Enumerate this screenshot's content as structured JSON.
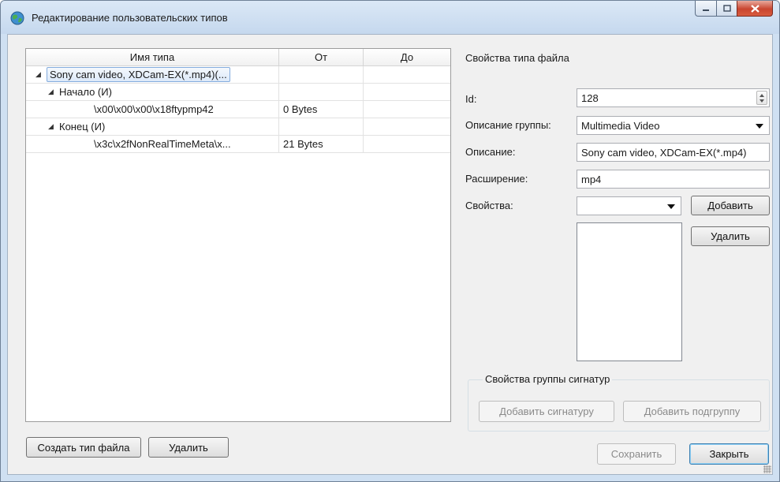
{
  "window": {
    "title": "Редактирование пользовательских типов"
  },
  "tree": {
    "columns": [
      "Имя типа",
      "От",
      "До"
    ],
    "rows": [
      {
        "name": "Sony cam video, XDCam-EX(*.mp4)(...",
        "from": "",
        "to": "",
        "expanded": true,
        "selected": true
      },
      {
        "name": "Начало (И)",
        "from": "",
        "to": "",
        "expanded": true
      },
      {
        "name": "\\x00\\x00\\x00\\x18ftypmp42",
        "from": "0 Bytes",
        "to": ""
      },
      {
        "name": "Конец (И)",
        "from": "",
        "to": "",
        "expanded": true
      },
      {
        "name": "\\x3c\\x2fNonRealTimeMeta\\x...",
        "from": "21 Bytes",
        "to": ""
      }
    ]
  },
  "left_buttons": {
    "create": "Создать тип файла",
    "delete": "Удалить"
  },
  "properties": {
    "heading": "Свойства типа файла",
    "id_label": "Id:",
    "id_value": "128",
    "group_label": "Описание группы:",
    "group_value": "Multimedia Video",
    "desc_label": "Описание:",
    "desc_value": "Sony cam video, XDCam-EX(*.mp4)",
    "ext_label": "Расширение:",
    "ext_value": "mp4",
    "props_label": "Свойства:",
    "props_value": "",
    "add_button": "Добавить",
    "remove_button": "Удалить"
  },
  "signature_group": {
    "title": "Свойства группы сигнатур",
    "add_signature": "Добавить сигнатуру",
    "add_subgroup": "Добавить подгруппу"
  },
  "bottom_buttons": {
    "save": "Сохранить",
    "close": "Закрыть"
  }
}
